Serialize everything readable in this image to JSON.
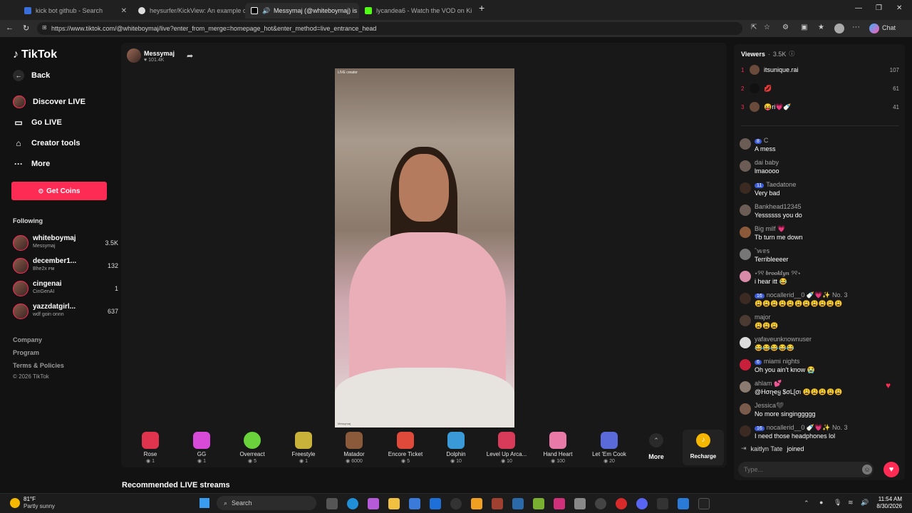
{
  "browser": {
    "tabs": [
      {
        "label": "kick bot github - Search",
        "active": false
      },
      {
        "label": "heysurfer/KickView: An example c",
        "active": false
      },
      {
        "label": "Messymaj (@whiteboymaj) is",
        "active": true
      },
      {
        "label": "lycandea6 - Watch the VOD on Ki",
        "active": false
      }
    ],
    "url": "https://www.tiktok.com/@whiteboymaj/live?enter_from_merge=homepage_hot&enter_method=live_entrance_head",
    "chat_label": "Chat"
  },
  "sidebar": {
    "logo": "TikTok",
    "back": "Back",
    "discover": "Discover LIVE",
    "golive": "Go LIVE",
    "creator": "Creator tools",
    "more": "More",
    "get_coins": "Get Coins",
    "following_header": "Following",
    "following": [
      {
        "name": "whiteboymaj",
        "sub": "Messymaj",
        "count": "3.5K"
      },
      {
        "name": "december1...",
        "sub": "Bhe2x ᴘᴍ",
        "count": "132"
      },
      {
        "name": "cingenai",
        "sub": "CinGenAI",
        "count": "1"
      },
      {
        "name": "yazzdatgirl...",
        "sub": "wdf goin onnn",
        "count": "637"
      }
    ],
    "footer": [
      "Company",
      "Program",
      "Terms & Policies",
      "© 2026 TikTok"
    ]
  },
  "stream": {
    "host_name": "Messymaj",
    "host_likes": "101.4K",
    "video_tag": "LIVE creator",
    "video_watermark": "Messymaj"
  },
  "gifts": [
    {
      "name": "Rose",
      "price": "1",
      "color": "#e0334e"
    },
    {
      "name": "GG",
      "price": "1",
      "color": "#d84bd8"
    },
    {
      "name": "Overreact",
      "price": "5",
      "color": "#6ad23a"
    },
    {
      "name": "Freestyle",
      "price": "1",
      "color": "#c9b23a"
    },
    {
      "name": "Matador",
      "price": "6000",
      "color": "#8a5a3a"
    },
    {
      "name": "Encore Ticket",
      "price": "5",
      "color": "#e04a3a"
    },
    {
      "name": "Dolphin",
      "price": "10",
      "color": "#3a9ad8"
    },
    {
      "name": "Level Up Arca...",
      "price": "10",
      "color": "#d83a5a"
    },
    {
      "name": "Hand Heart",
      "price": "100",
      "color": "#e87aa8"
    },
    {
      "name": "Let 'Em Cook",
      "price": "20",
      "color": "#5a6ad8"
    }
  ],
  "gifts_more": "More",
  "recharge": "Recharge",
  "recommended": "Recommended LIVE streams",
  "viewers": {
    "label": "Viewers",
    "count": "3.5K",
    "top": [
      {
        "rank": "1",
        "name": "itsunique.rai",
        "score": "107"
      },
      {
        "rank": "2",
        "name": "💋",
        "score": "61"
      },
      {
        "rank": "3",
        "name": "😝ri💗🍼",
        "score": "41"
      }
    ]
  },
  "chat": [
    {
      "user": "C",
      "badge": "8",
      "msg": "A mess"
    },
    {
      "user": "dai baby",
      "badge": "",
      "msg": "lmaoooo"
    },
    {
      "user": "Taedatone",
      "badge": "11",
      "msg": "Very bad"
    },
    {
      "user": "Bankhead12345",
      "badge": "",
      "msg": "Yessssss you do"
    },
    {
      "user": "Big milf 💗",
      "badge": "",
      "msg": "Tb turn me down"
    },
    {
      "user": "ˆ𝕨𝕖𝕤",
      "badge": "",
      "msg": "Terribleeeer"
    },
    {
      "user": "⋆୨୧ 𝒃𝒓𝒐𝒐𝒌𝒍𝒚𝒏 ୨୧⋆",
      "badge": "",
      "msg": "i hear itt 😂"
    },
    {
      "user": "nocallerid__0 🍼💗✨ No. 3",
      "badge": "16",
      "msg": "😩😩😩😩😩😩😩😩😩😩😩"
    },
    {
      "user": "major",
      "badge": "",
      "msg": "😩😩😩"
    },
    {
      "user": "yafaveunknownuser",
      "badge": "",
      "msg": "😂😂😂😂😂"
    },
    {
      "user": "miami nights",
      "badge": "6",
      "msg": "Oh you ain't know 😭"
    },
    {
      "user": "ahlam 💕",
      "badge": "",
      "msg": "@Hσɳҽყ $σL[σι 😩😩😩😩😩"
    },
    {
      "user": "Jessica🖤",
      "badge": "",
      "msg": "No more singinggggg"
    },
    {
      "user": "nocallerid__0 🍼💗✨ No. 3",
      "badge": "16",
      "msg": "I need those headphones lol"
    }
  ],
  "joined": {
    "user": "kaitlyn Tate",
    "text": "joined"
  },
  "type_placeholder": "Type...",
  "taskbar": {
    "weather_temp": "81°F",
    "weather_desc": "Partly sunny",
    "search": "Search",
    "time": "11:54 AM",
    "date": "8/30/2026"
  }
}
